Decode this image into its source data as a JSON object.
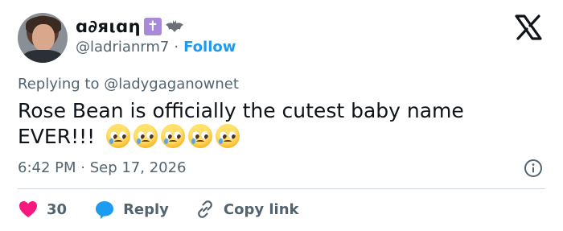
{
  "user": {
    "display_name": "ɑ∂яιɑη",
    "badge_symbol": "✝",
    "handle": "@ladrianrm7",
    "separator": "·",
    "follow_label": "Follow"
  },
  "reply_to": "Replying to @ladygaganownet",
  "tweet": {
    "text": "Rose Bean is officially the cutest baby name EVER!!!",
    "emoji_count": 5,
    "emoji_name": "pleading-face-with-tear"
  },
  "timestamp": "6:42 PM · Sep 17, 2026",
  "actions": {
    "like_count": "30",
    "reply_label": "Reply",
    "copy_link_label": "Copy link"
  },
  "icons": {
    "brand": "x-logo-icon",
    "info": "info-icon",
    "like": "heart-icon",
    "reply": "reply-bubble-icon",
    "copy": "link-icon",
    "bat": "bat-icon"
  },
  "colors": {
    "accent": "#1d9bf0",
    "heart": "#f91880",
    "text": "#0f1419",
    "muted": "#536471",
    "badge": "#a78bd8"
  }
}
